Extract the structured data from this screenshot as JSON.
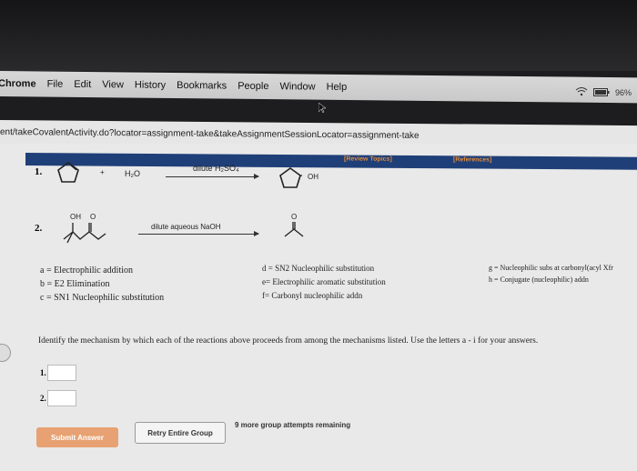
{
  "menubar": {
    "app": "Chrome",
    "items": [
      "File",
      "Edit",
      "View",
      "History",
      "Bookmarks",
      "People",
      "Window",
      "Help"
    ]
  },
  "tray": {
    "battery": "96%"
  },
  "url": "ent/takeCovalentActivity.do?locator=assignment-take&takeAssignmentSessionLocator=assignment-take",
  "toolbar": {
    "review": "[Review Topics]",
    "references": "[References]"
  },
  "reactions": [
    {
      "num": "1.",
      "reagent": "H₂O",
      "condition": "dilute H₂SO₄",
      "oh": "OH",
      "plus": "+"
    },
    {
      "num": "2.",
      "condition": "dilute aqueous NaOH",
      "oh": "OH",
      "o": "O",
      "o2": "O"
    }
  ],
  "mechanisms_col1": [
    "a = Electrophilic addition",
    "b = E2 Elimination",
    "c = SN1 Nucleophilic substitution"
  ],
  "mechanisms_col2": [
    "d = SN2 Nucleophilic substitution",
    "e= Electrophilic aromatic substitution",
    "f= Carbonyl nucleophilic addn"
  ],
  "mechanisms_col3": [
    "g = Nucleophilic subs at carbonyl(acyl Xfr",
    "h = Conjugate (nucleophilic) addn"
  ],
  "question": "Identify the mechanism by which each of the reactions above proceeds from among the mechanisms listed. Use the letters a - i for your answers.",
  "answers": [
    {
      "label": "1.",
      "value": ""
    },
    {
      "label": "2.",
      "value": ""
    }
  ],
  "buttons": {
    "submit": "Submit Answer",
    "retry": "Retry Entire Group"
  },
  "attempts": "9 more group attempts remaining"
}
